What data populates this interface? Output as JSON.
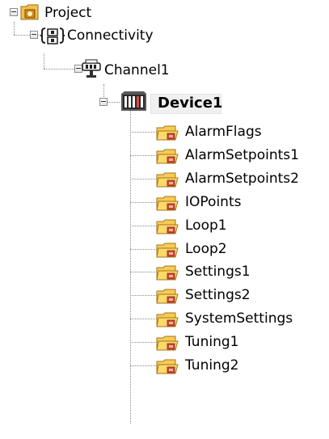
{
  "tree": {
    "project": {
      "label": "Project",
      "icon": "project-folder-icon"
    },
    "connectivity": {
      "label": "Connectivity",
      "icon": "connectivity-icon"
    },
    "channel": {
      "label": "Channel1",
      "icon": "channel-network-icon"
    },
    "device": {
      "label": "Device1",
      "icon": "device-icon"
    },
    "groups": [
      {
        "label": "AlarmFlags"
      },
      {
        "label": "AlarmSetpoints1"
      },
      {
        "label": "AlarmSetpoints2"
      },
      {
        "label": "IOPoints"
      },
      {
        "label": "Loop1"
      },
      {
        "label": "Loop2"
      },
      {
        "label": "Settings1"
      },
      {
        "label": "Settings2"
      },
      {
        "label": "SystemSettings"
      },
      {
        "label": "Tuning1"
      },
      {
        "label": "Tuning2"
      }
    ]
  },
  "colors": {
    "folder": "#f5c242",
    "selection": "#f0f0f0",
    "device_red": "#c0392b"
  }
}
